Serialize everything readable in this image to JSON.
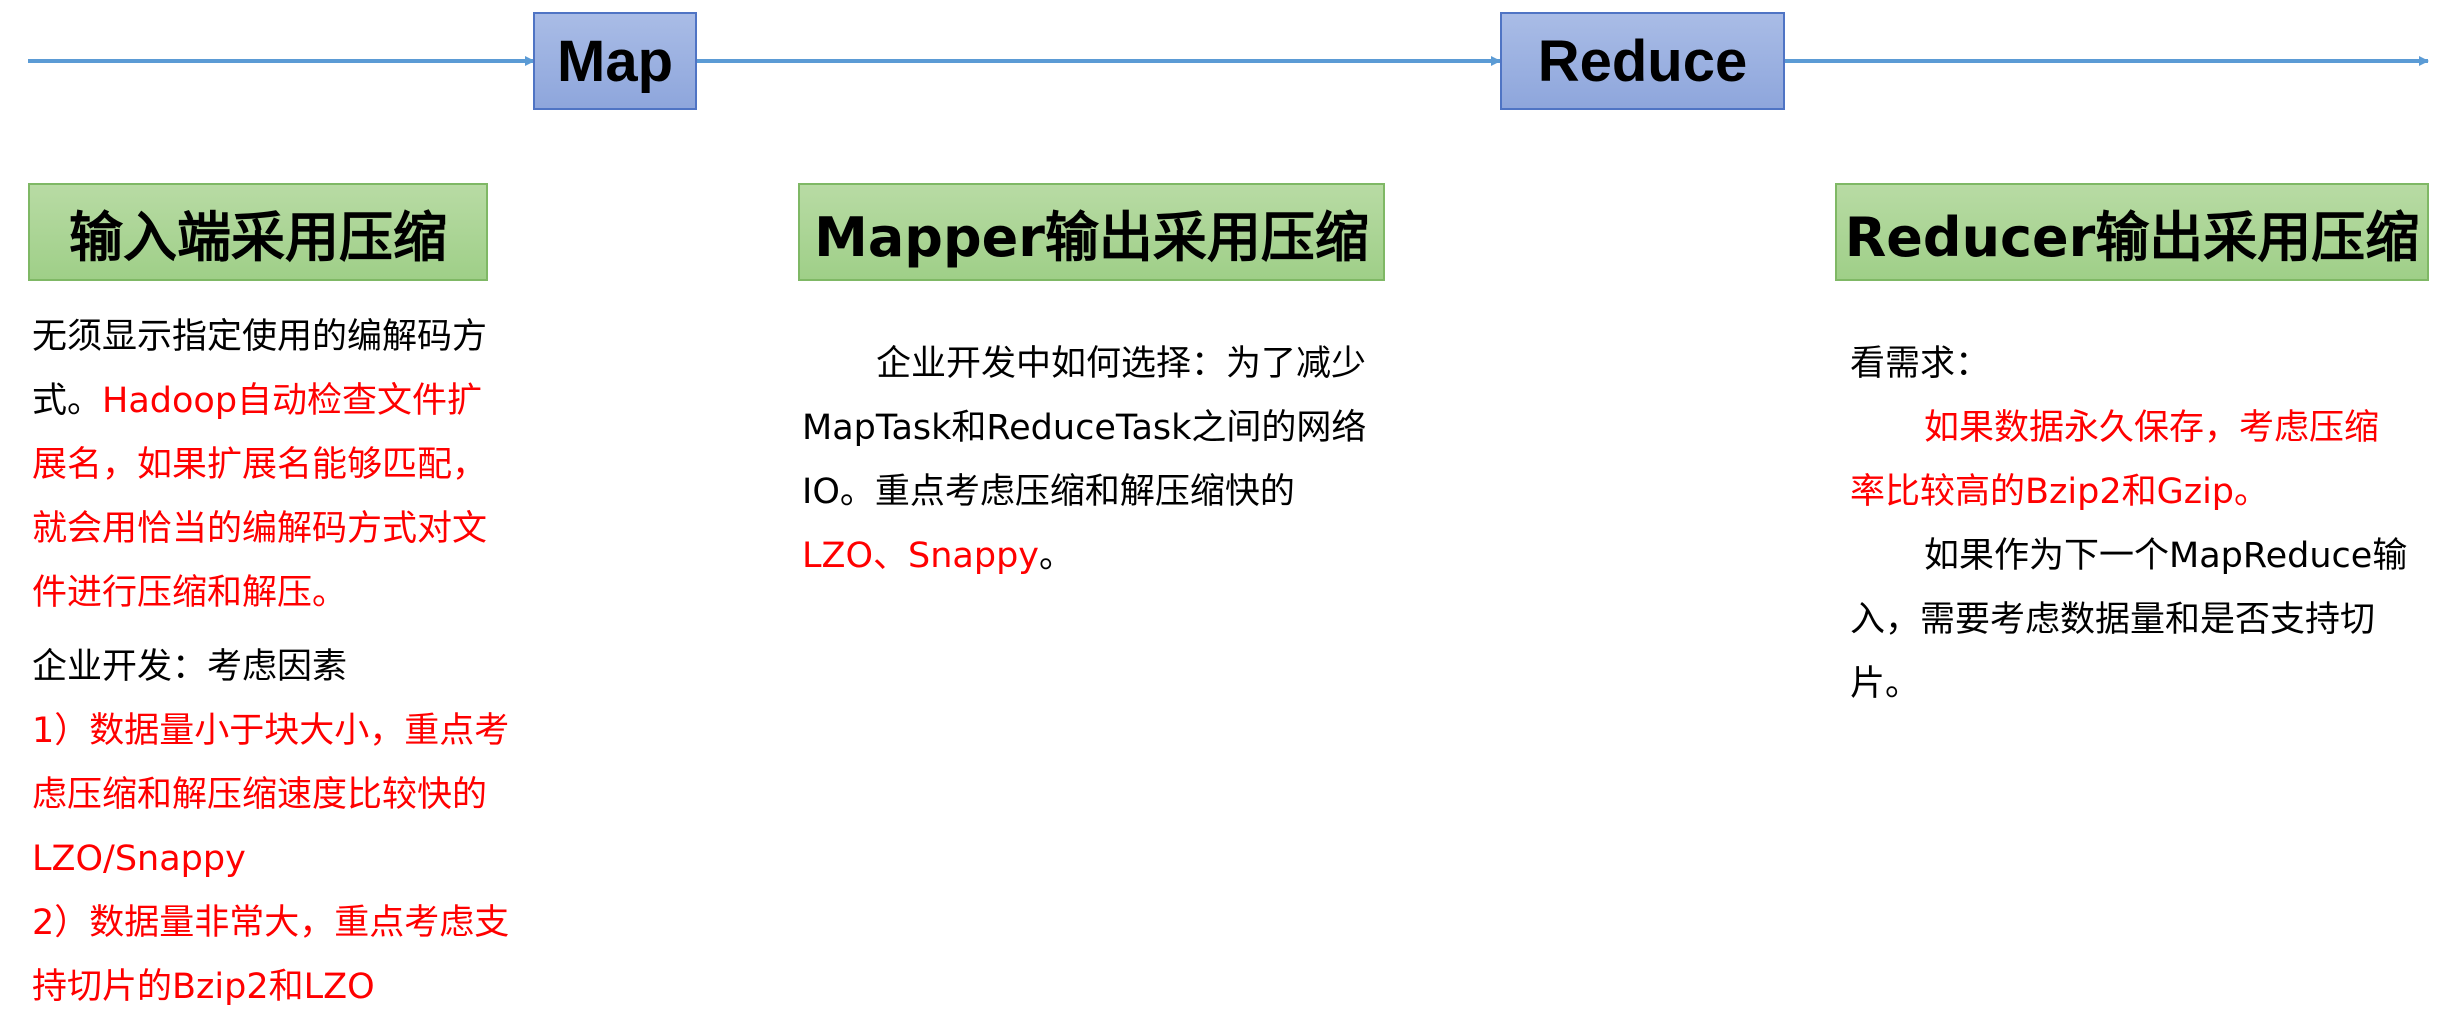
{
  "stages": {
    "map": "Map",
    "reduce": "Reduce"
  },
  "headers": {
    "input": "输入端采用压缩",
    "mapper": "Mapper输出采用压缩",
    "reducer": "Reducer输出采用压缩"
  },
  "input_col": {
    "p1_black": "无须显示指定使用的编解码方式。",
    "p1_red": "Hadoop自动检查文件扩展名，如果扩展名能够匹配，就会用恰当的编解码方式对文件进行压缩和解压。",
    "p2_title": "企业开发：考虑因素",
    "p2_item1": "1）数据量小于块大小，重点考虑压缩和解压缩速度比较快的LZO/Snappy",
    "p2_item2": "2）数据量非常大，重点考虑支持切片的Bzip2和LZO"
  },
  "mapper_col": {
    "p1_black": "企业开发中如何选择：为了减少MapTask和ReduceTask之间的网络IO。重点考虑压缩和解压缩快的",
    "p1_red": "LZO、Snappy",
    "p1_end": "。"
  },
  "reducer_col": {
    "p1": "看需求：",
    "p2_red": "如果数据永久保存，考虑压缩率比较高的Bzip2和Gzip。",
    "p3": "如果作为下一个MapReduce输入，需要考虑数据量和是否支持切片。"
  },
  "colors": {
    "arrow": "#5b9bd5",
    "stage_fill": "#8ea6dc",
    "header_fill": "#a9d18e",
    "highlight": "#ff0000"
  }
}
